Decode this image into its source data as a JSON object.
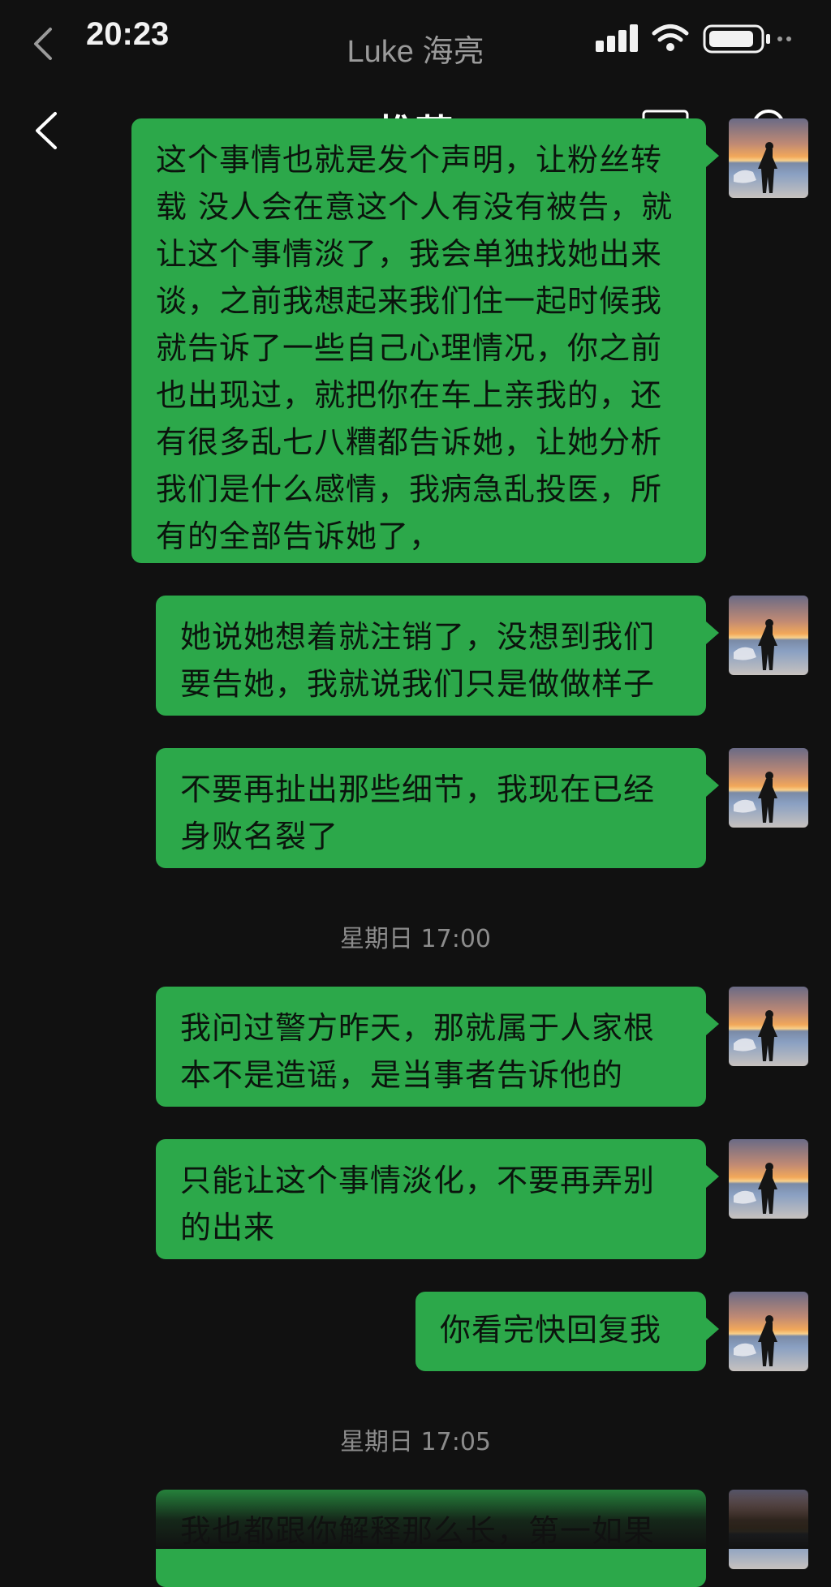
{
  "statusbar": {
    "time": "20:23",
    "chat_title": "Luke 海亮",
    "icons": [
      "back-chevron-icon",
      "signal-icon",
      "wifi-icon",
      "battery-icon"
    ]
  },
  "overlay": {
    "title": "推荐",
    "icons": [
      "back-arrow-icon",
      "screen-cast-icon",
      "search-icon"
    ]
  },
  "messages": [
    {
      "type": "sent",
      "text": "这个事情也就是发个声明，让粉丝转载 没人会在意这个人有没有被告，就让这个事情淡了，我会单独找她出来谈，之前我想起来我们住一起时候我就告诉了一些自己心理情况，你之前也出现过，就把你在车上亲我的，还有很多乱七八糟都告诉她，让她分析我们是什么感情，我病急乱投医，所有的全部告诉她了，"
    },
    {
      "type": "sent",
      "text": "她说她想着就注销了，没想到我们要告她，我就说我们只是做做样子"
    },
    {
      "type": "sent",
      "text": "不要再扯出那些细节，我现在已经身败名裂了"
    },
    {
      "type": "time",
      "text": "星期日 17:00"
    },
    {
      "type": "sent",
      "text": "我问过警方昨天，那就属于人家根本不是造谣，是当事者告诉他的"
    },
    {
      "type": "sent",
      "text": "只能让这个事情淡化，不要再弄别的出来"
    },
    {
      "type": "sent",
      "text": "你看完快回复我"
    },
    {
      "type": "time",
      "text": "星期日 17:05"
    },
    {
      "type": "sent",
      "text": "我也都跟你解释那么长，第一如果"
    }
  ],
  "colors": {
    "bubble": "#2ca84a",
    "background": "#111111"
  }
}
